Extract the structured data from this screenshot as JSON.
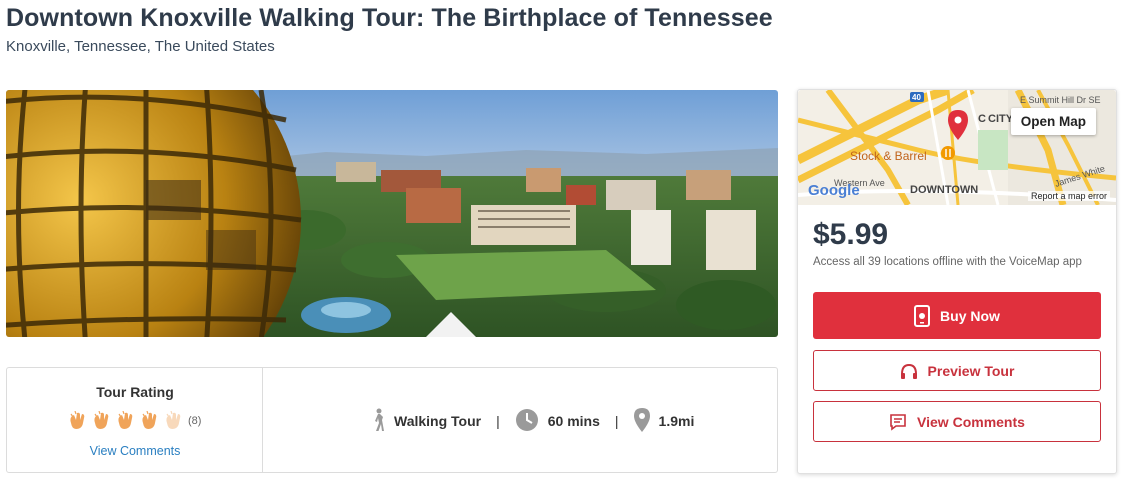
{
  "header": {
    "title": "Downtown Knoxville Walking Tour: The Birthplace of Tennessee",
    "location": "Knoxville, Tennessee, The United States"
  },
  "hero": {
    "image_alt": "Aerial view of downtown Knoxville with the Sunsphere"
  },
  "rating": {
    "title": "Tour Rating",
    "count": "(8)",
    "value_out_of_5": 4.5,
    "view_comments": "View Comments"
  },
  "stats": {
    "type": "Walking Tour",
    "duration": "60 mins",
    "distance": "1.9mi",
    "separator": "|"
  },
  "map": {
    "open_map": "Open Map",
    "google": "Google",
    "report": "Report a map error",
    "labels": {
      "city": "CITY",
      "city_prefix": "C",
      "summit": "E Summit Hill Dr SE",
      "stock": "Stock & Barrel",
      "downtown": "DOWNTOWN",
      "western": "Western Ave",
      "james_white": "James White",
      "route": "40"
    }
  },
  "purchase": {
    "price": "$5.99",
    "offline_note": "Access all 39 locations offline with the VoiceMap app",
    "buy_now": "Buy Now",
    "preview_tour": "Preview Tour",
    "view_comments": "View Comments"
  },
  "colors": {
    "accent_red": "#e0303d",
    "link_blue": "#2a7fc1",
    "clap_orange": "#f0a45a"
  }
}
